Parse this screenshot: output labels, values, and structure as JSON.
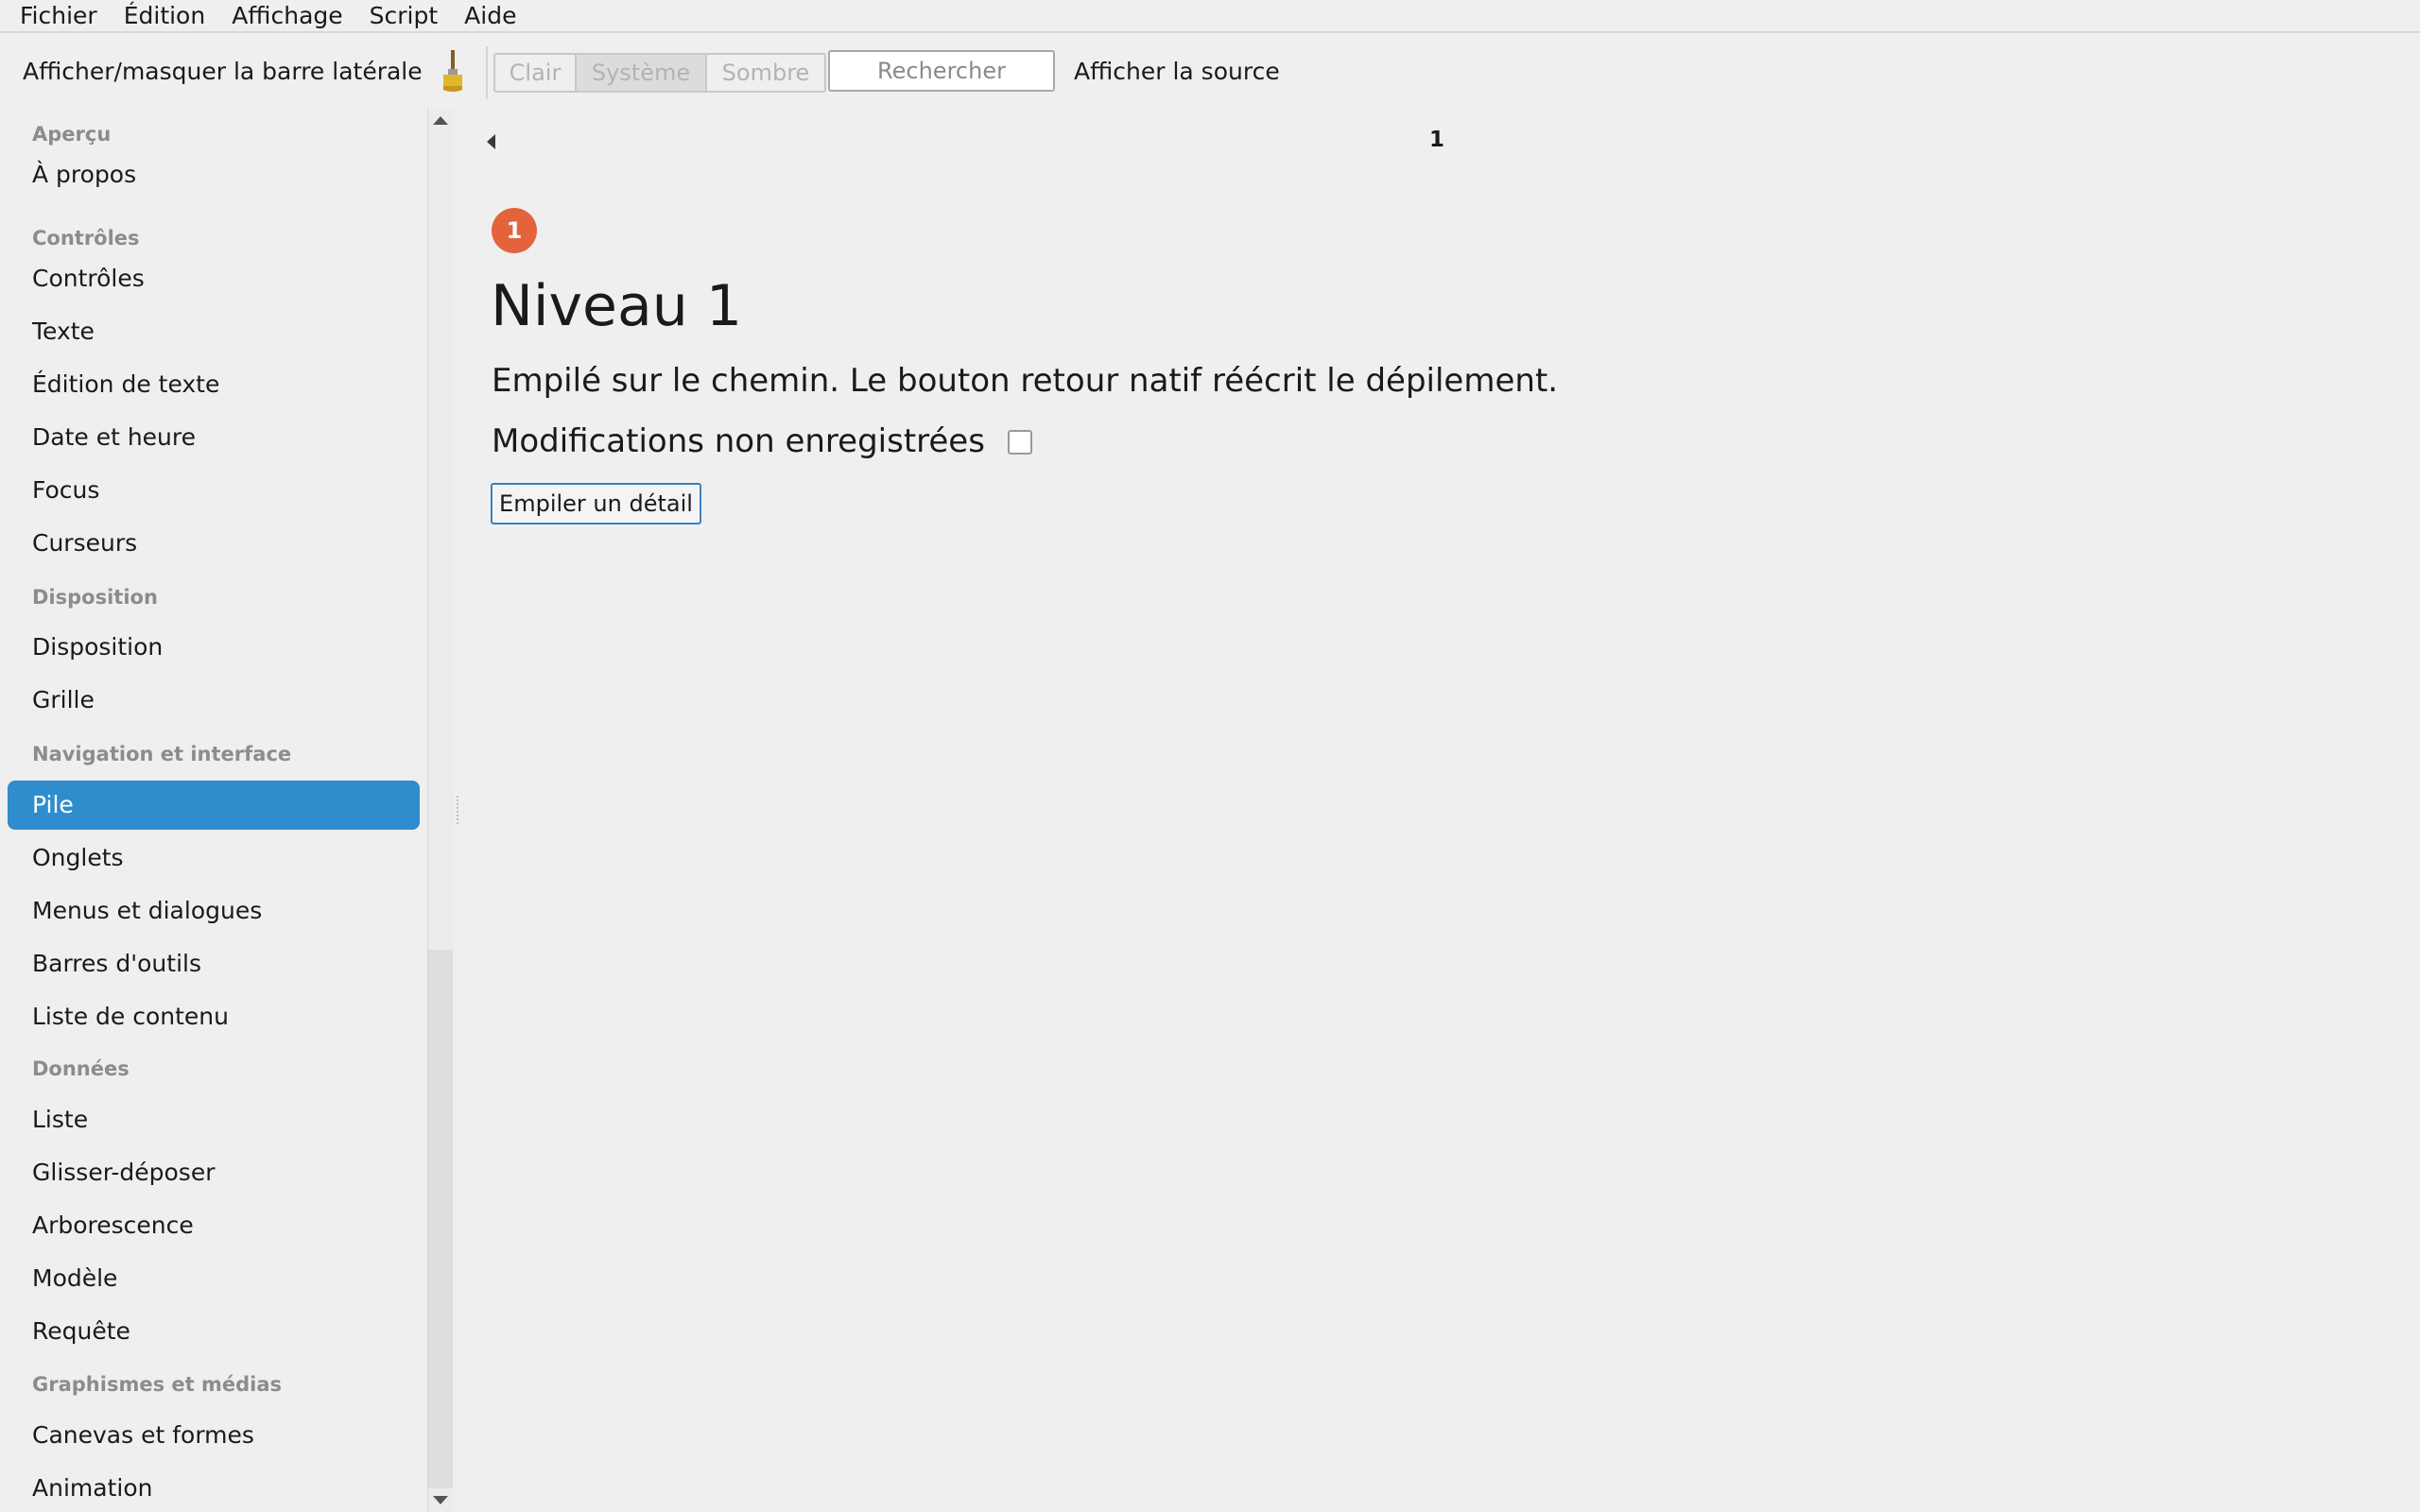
{
  "menubar": {
    "items": [
      "Fichier",
      "Édition",
      "Affichage",
      "Script",
      "Aide"
    ]
  },
  "toolbar": {
    "sidebar_toggle_label": "Afficher/masquer la barre latérale",
    "brush_icon": "paintbrush-icon",
    "theme_options": [
      "Clair",
      "Système",
      "Sombre"
    ],
    "theme_selected": "Système",
    "search_placeholder": "Rechercher",
    "show_source_label": "Afficher la source"
  },
  "sidebar": {
    "entries": [
      {
        "type": "heading",
        "label": "Aperçu"
      },
      {
        "type": "item",
        "label": "À propos"
      },
      {
        "type": "heading",
        "label": "Contrôles"
      },
      {
        "type": "item",
        "label": "Contrôles"
      },
      {
        "type": "item",
        "label": "Texte"
      },
      {
        "type": "item",
        "label": "Édition de texte"
      },
      {
        "type": "item",
        "label": "Date et heure"
      },
      {
        "type": "item",
        "label": "Focus"
      },
      {
        "type": "item",
        "label": "Curseurs"
      },
      {
        "type": "heading",
        "label": "Disposition"
      },
      {
        "type": "item",
        "label": "Disposition"
      },
      {
        "type": "item",
        "label": "Grille"
      },
      {
        "type": "heading",
        "label": "Navigation et interface"
      },
      {
        "type": "item",
        "label": "Pile",
        "selected": true
      },
      {
        "type": "item",
        "label": "Onglets"
      },
      {
        "type": "item",
        "label": "Menus et dialogues"
      },
      {
        "type": "item",
        "label": "Barres d'outils"
      },
      {
        "type": "item",
        "label": "Liste de contenu"
      },
      {
        "type": "heading",
        "label": "Données"
      },
      {
        "type": "item",
        "label": "Liste"
      },
      {
        "type": "item",
        "label": "Glisser-déposer"
      },
      {
        "type": "item",
        "label": "Arborescence"
      },
      {
        "type": "item",
        "label": "Modèle"
      },
      {
        "type": "item",
        "label": "Requête"
      },
      {
        "type": "heading",
        "label": "Graphismes et médias"
      },
      {
        "type": "item",
        "label": "Canevas et formes"
      },
      {
        "type": "item",
        "label": "Animation"
      }
    ]
  },
  "content": {
    "nav_title": "1",
    "badge": "1",
    "badge_color": "#e4633c",
    "title": "Niveau 1",
    "description": "Empilé sur le chemin. Le bouton retour natif réécrit le dépilement.",
    "unsaved_label": "Modifications non enregistrées",
    "unsaved_checked": false,
    "push_button_label": "Empiler un détail"
  },
  "colors": {
    "selection": "#2f8ccd",
    "background": "#efefef"
  }
}
